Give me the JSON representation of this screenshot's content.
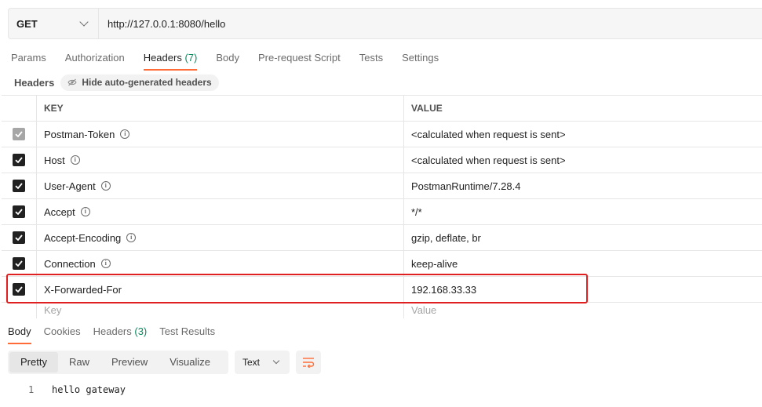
{
  "request": {
    "method": "GET",
    "url": "http://127.0.0.1:8080/hello"
  },
  "request_tabs": [
    {
      "label": "Params"
    },
    {
      "label": "Authorization"
    },
    {
      "label": "Headers",
      "count": "(7)",
      "active": true
    },
    {
      "label": "Body"
    },
    {
      "label": "Pre-request Script"
    },
    {
      "label": "Tests"
    },
    {
      "label": "Settings"
    }
  ],
  "headers_section": {
    "title": "Headers",
    "hide_button": "Hide auto-generated headers",
    "hide_icon": "eye-off-icon"
  },
  "table": {
    "key_header": "KEY",
    "value_header": "VALUE",
    "rows": [
      {
        "key": "Postman-Token",
        "value": "<calculated when request is sent>",
        "checked": true,
        "disabled": true
      },
      {
        "key": "Host",
        "value": "<calculated when request is sent>",
        "checked": true
      },
      {
        "key": "User-Agent",
        "value": "PostmanRuntime/7.28.4",
        "checked": true
      },
      {
        "key": "Accept",
        "value": "*/*",
        "checked": true
      },
      {
        "key": "Accept-Encoding",
        "value": "gzip, deflate, br",
        "checked": true
      },
      {
        "key": "Connection",
        "value": "keep-alive",
        "checked": true
      },
      {
        "key": "X-Forwarded-For",
        "value": "192.168.33.33",
        "checked": true,
        "highlighted": true
      }
    ],
    "new_key_placeholder": "Key",
    "new_value_placeholder": "Value"
  },
  "response_tabs": [
    {
      "label": "Body",
      "active": true
    },
    {
      "label": "Cookies"
    },
    {
      "label": "Headers",
      "count": "(3)"
    },
    {
      "label": "Test Results"
    }
  ],
  "response_view": {
    "modes": [
      "Pretty",
      "Raw",
      "Preview",
      "Visualize"
    ],
    "active_mode": "Pretty",
    "format": "Text",
    "wrap_icon": "wrap-lines-icon"
  },
  "response_body": {
    "lines": [
      {
        "no": "1",
        "text": "hello gateway"
      }
    ]
  },
  "colors": {
    "accent": "#ff6c37",
    "count": "#0a8a5f",
    "highlight_border": "#e02020"
  }
}
